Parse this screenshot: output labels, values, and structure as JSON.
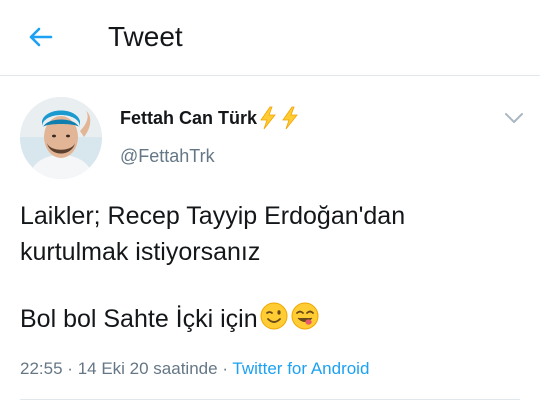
{
  "header": {
    "title": "Tweet",
    "back_icon": "arrow-left-icon",
    "accent_color": "#1da1f2"
  },
  "tweet": {
    "author": {
      "display_name": "Fettah Can Türk",
      "name_emoji": [
        "high-voltage-emoji",
        "high-voltage-emoji"
      ],
      "handle": "@FettahTrk"
    },
    "text_lines": [
      "Laikler; Recep Tayyip Erdoğan'dan",
      "kurtulmak istiyorsanız",
      "Bol bol Sahte İçki için"
    ],
    "text_emoji": [
      "winking-face-emoji",
      "face-savoring-food-emoji"
    ],
    "time": "22:55",
    "date": "14 Eki 20 saatinde",
    "separator": "·",
    "source": "Twitter for Android",
    "more_icon": "chevron-down-icon"
  }
}
